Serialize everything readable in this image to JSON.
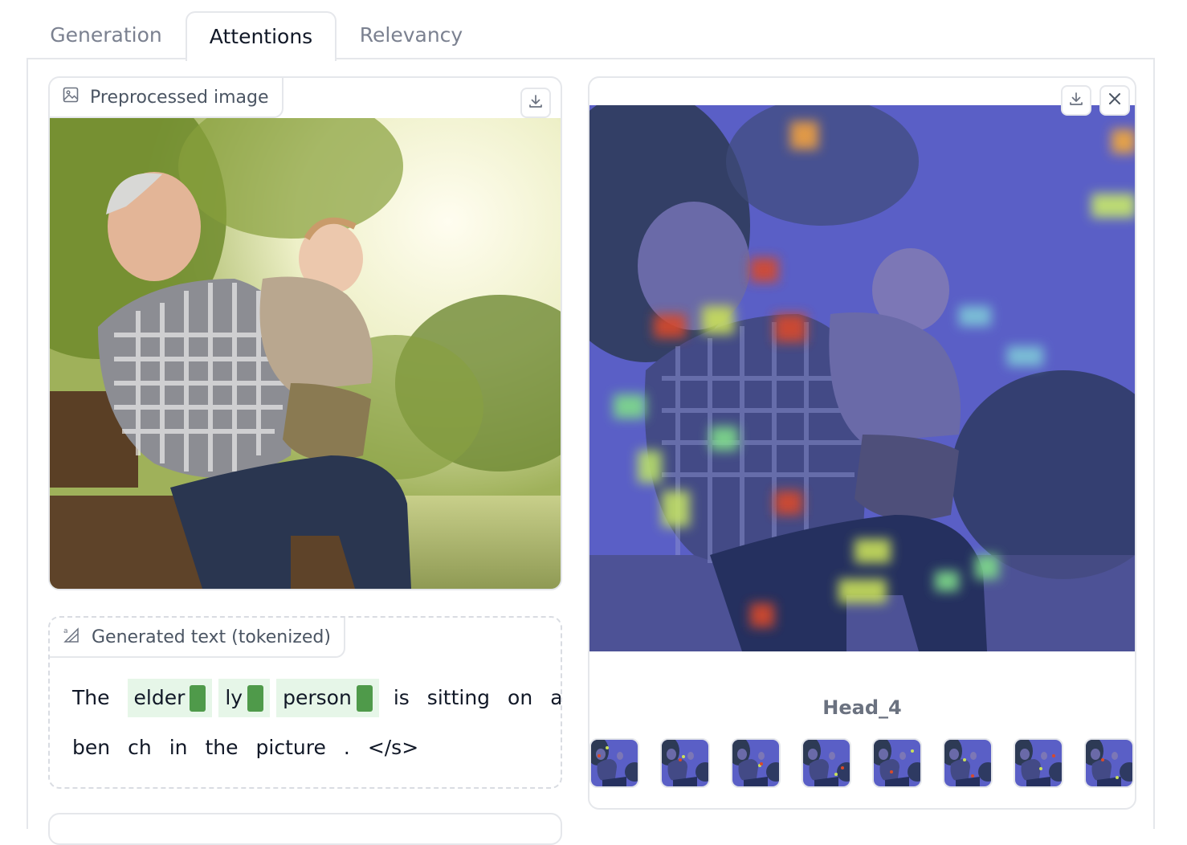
{
  "tabs": [
    {
      "label": "Generation",
      "active": false
    },
    {
      "label": "Attentions",
      "active": true
    },
    {
      "label": "Relevancy",
      "active": false
    }
  ],
  "preprocessed": {
    "label": "Preprocessed image",
    "icon": "image-icon",
    "download_icon": "download-icon"
  },
  "generated_text": {
    "label": "Generated text (tokenized)",
    "icon": "text-tokens-icon",
    "line1": [
      {
        "text": "The",
        "highlight": false
      },
      {
        "text": "elder",
        "highlight": true
      },
      {
        "text": "ly",
        "highlight": true
      },
      {
        "text": "person",
        "highlight": true
      },
      {
        "text": "is",
        "highlight": false
      },
      {
        "text": "sitting",
        "highlight": false
      },
      {
        "text": "on",
        "highlight": false
      },
      {
        "text": "a",
        "highlight": false
      }
    ],
    "line2": [
      {
        "text": "ben",
        "highlight": false
      },
      {
        "text": "ch",
        "highlight": false
      },
      {
        "text": "in",
        "highlight": false
      },
      {
        "text": "the",
        "highlight": false
      },
      {
        "text": "picture",
        "highlight": false
      },
      {
        "text": ".",
        "highlight": false
      },
      {
        "text": "</s>",
        "highlight": false
      }
    ],
    "highlight_color": "#e6f6e8",
    "bar_color": "#4f9a4a"
  },
  "gallery": {
    "caption": "Head_4",
    "thumbnail_count": 8,
    "download_icon": "download-icon",
    "close_icon": "close-icon"
  }
}
